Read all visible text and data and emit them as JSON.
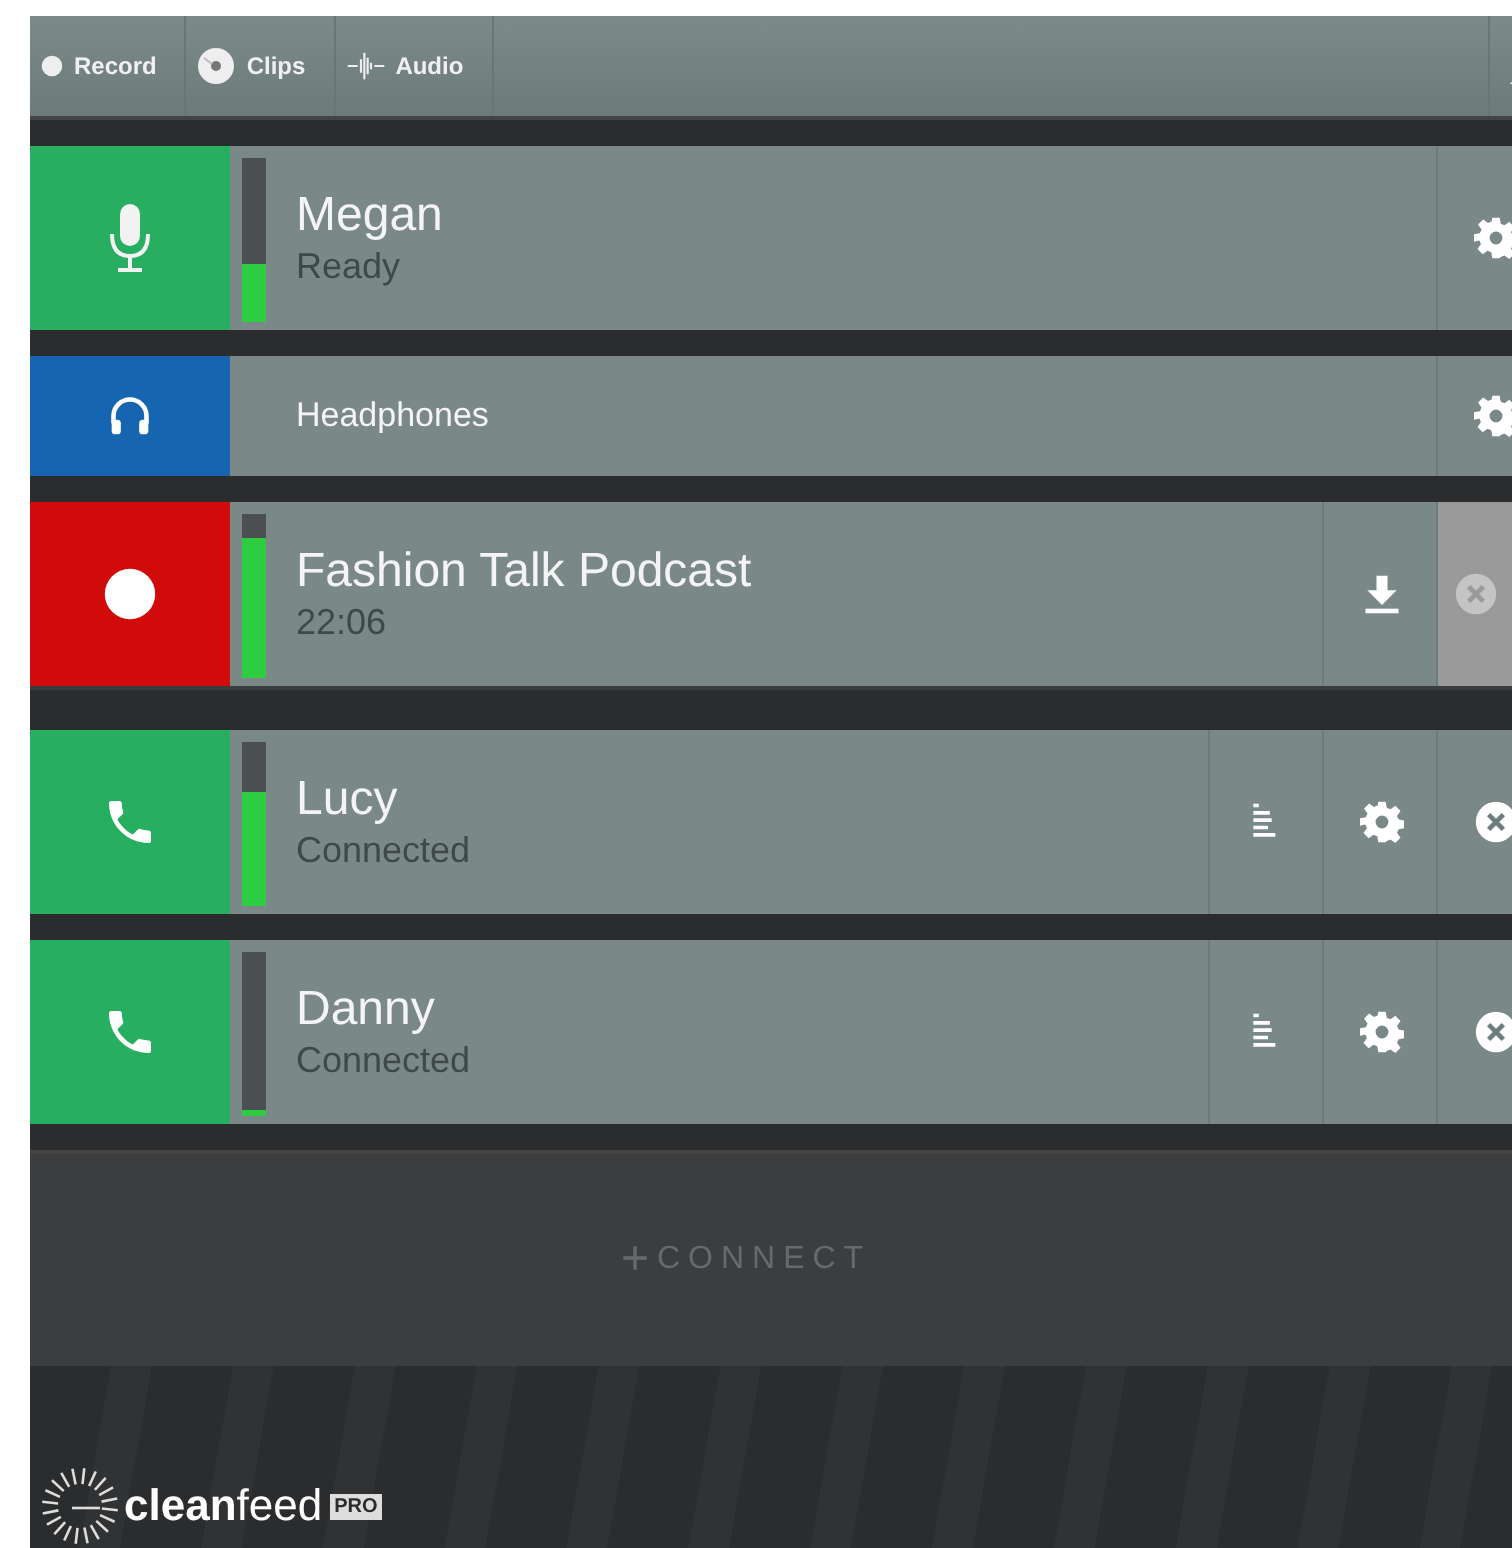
{
  "toolbar": {
    "tabs": [
      {
        "label": "Record",
        "kind": "record"
      },
      {
        "label": "Clips",
        "kind": "clips"
      },
      {
        "label": "Audio",
        "kind": "audio"
      }
    ]
  },
  "channels": [
    {
      "kind": "mic",
      "name": "Megan",
      "status": "Ready",
      "level": 0.35,
      "actions": [
        {
          "kind": "settings",
          "disabled": false
        }
      ]
    },
    {
      "kind": "headphones",
      "name": "Headphones",
      "actions": [
        {
          "kind": "settings",
          "disabled": false
        }
      ]
    },
    {
      "kind": "record",
      "name": "Fashion Talk Podcast",
      "status": "22:06",
      "level": 0.85,
      "actions": [
        {
          "kind": "download",
          "disabled": false
        },
        {
          "kind": "close",
          "disabled": true
        }
      ]
    },
    {
      "kind": "call",
      "name": "Lucy",
      "status": "Connected",
      "level": 0.7,
      "actions": [
        {
          "kind": "transcript",
          "disabled": false
        },
        {
          "kind": "settings",
          "disabled": false
        },
        {
          "kind": "close",
          "disabled": false
        }
      ]
    },
    {
      "kind": "call",
      "name": "Danny",
      "status": "Connected",
      "level": 0.04,
      "actions": [
        {
          "kind": "transcript",
          "disabled": false
        },
        {
          "kind": "settings",
          "disabled": false
        },
        {
          "kind": "close",
          "disabled": false
        }
      ]
    }
  ],
  "connect": {
    "plus": "+",
    "label": "CONNECT"
  },
  "footer": {
    "logo": "**clean**feed",
    "badge": "PRO"
  }
}
